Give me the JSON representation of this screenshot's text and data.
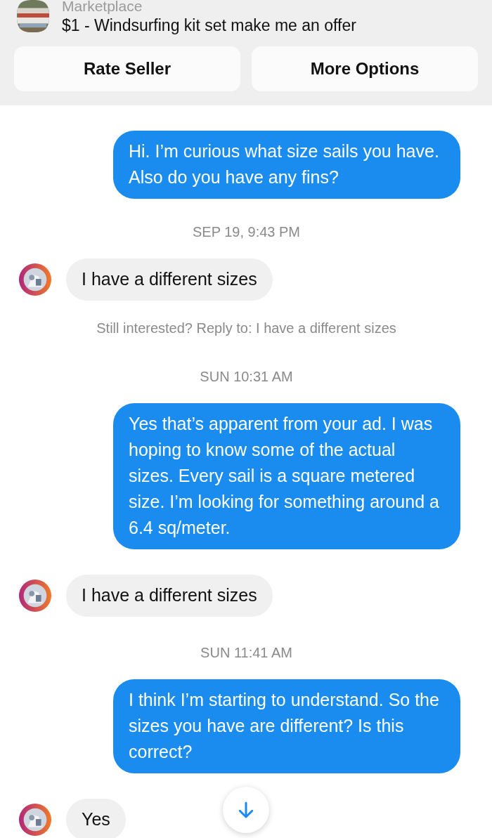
{
  "header": {
    "category": "Marketplace",
    "listing_title": "$1 - Windsurfing kit set make me an offer",
    "buttons": [
      "Rate Seller",
      "More Options"
    ]
  },
  "messages": [
    {
      "kind": "sent",
      "text": "Hi. I’m curious what size sails you have. Also do you have any fins?"
    },
    {
      "kind": "timestamp",
      "text": "SEP 19, 9:43 PM"
    },
    {
      "kind": "received",
      "text": "I have a different sizes"
    },
    {
      "kind": "notice",
      "text": "Still interested? Reply to: I have a different sizes"
    },
    {
      "kind": "timestamp",
      "text": "SUN 10:31 AM"
    },
    {
      "kind": "sent",
      "text": "Yes that’s apparent from your ad. I was hoping to know some of the actual sizes. Every sail is a square metered size. I’m looking for something around a 6.4 sq/meter."
    },
    {
      "kind": "received",
      "text": "I have a different sizes"
    },
    {
      "kind": "timestamp",
      "text": "SUN 11:41 AM"
    },
    {
      "kind": "sent",
      "text": "I think I’m starting to understand. So the sizes you have are different? Is this correct?"
    },
    {
      "kind": "received",
      "text": "Yes"
    }
  ]
}
